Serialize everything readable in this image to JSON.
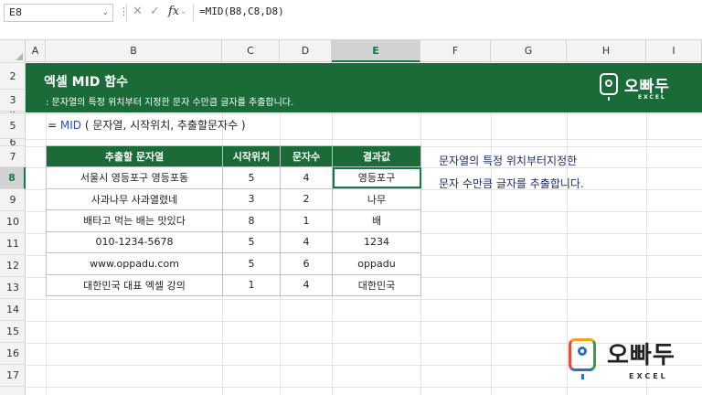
{
  "formula_bar": {
    "name_box": "E8",
    "formula": "=MID(B8,C8,D8)",
    "cancel_glyph": "✕",
    "enter_glyph": "✓",
    "fx_label": "fx"
  },
  "columns": [
    "A",
    "B",
    "C",
    "D",
    "E",
    "F",
    "G",
    "H",
    "I"
  ],
  "rows": [
    "1",
    "2",
    "3",
    "4",
    "5",
    "6",
    "7",
    "8",
    "9",
    "10",
    "11",
    "12",
    "13",
    "14",
    "15",
    "16",
    "17"
  ],
  "selected_cell": "E8",
  "banner": {
    "title": "엑셀 MID 함수",
    "subtitle": ": 문자열의 특정 위치부터 지정한 문자 수만큼 글자를 추출합니다.",
    "logo_name": "오빠두",
    "logo_sub": "EXCEL"
  },
  "syntax": {
    "prefix": "= ",
    "func": "MID",
    "args": " ( 문자열, 시작위치, 추출할문자수 )"
  },
  "table": {
    "headers": [
      "추출할 문자열",
      "시작위치",
      "문자수",
      "결과값"
    ],
    "rows": [
      [
        "서울시 영등포구 영등포동",
        "5",
        "4",
        "영등포구"
      ],
      [
        "사과나무 사과열렸네",
        "3",
        "2",
        "나무"
      ],
      [
        "배타고 먹는 배는 맛있다",
        "8",
        "1",
        "배"
      ],
      [
        "010-1234-5678",
        "5",
        "4",
        "1234"
      ],
      [
        "www.oppadu.com",
        "5",
        "6",
        "oppadu"
      ],
      [
        "대한민국 대표 엑셀 강의",
        "1",
        "4",
        "대한민국"
      ]
    ]
  },
  "note": {
    "line1": "문자열의 특정 위치부터지정한",
    "line2": "문자 수만큼 글자를 추출합니다."
  },
  "colors": {
    "brand_green": "#1a6b37",
    "selection_green": "#107c41",
    "func_blue": "#1f4ee0"
  }
}
